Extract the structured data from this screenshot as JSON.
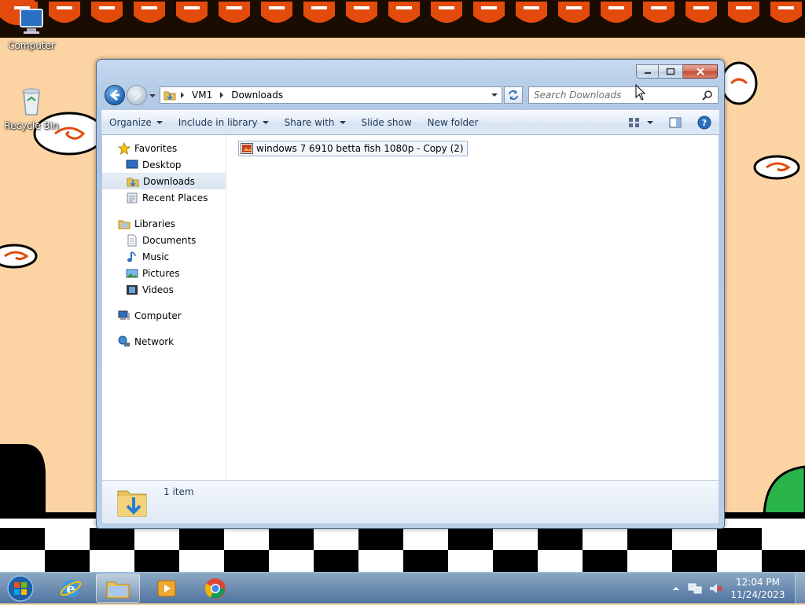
{
  "desktop": {
    "icons": [
      {
        "label": "Computer",
        "icon": "computer-icon"
      },
      {
        "label": "Recycle Bin",
        "icon": "recycle-bin-icon"
      }
    ]
  },
  "window": {
    "title": "Downloads",
    "breadcrumb": [
      "VM1",
      "Downloads"
    ],
    "search_placeholder": "Search Downloads",
    "toolbar": {
      "organize": "Organize",
      "include_in_library": "Include in library",
      "share_with": "Share with",
      "slide_show": "Slide show",
      "new_folder": "New folder"
    },
    "nav": {
      "favorites": {
        "label": "Favorites",
        "items": [
          "Desktop",
          "Downloads",
          "Recent Places"
        ]
      },
      "libraries": {
        "label": "Libraries",
        "items": [
          "Documents",
          "Music",
          "Pictures",
          "Videos"
        ]
      },
      "computer": "Computer",
      "network": "Network",
      "selected": "Downloads"
    },
    "files": [
      {
        "name": "windows 7 6910 betta fish 1080p - Copy (2)",
        "icon": "image-file-icon"
      }
    ],
    "details": {
      "count": "1 item"
    }
  },
  "taskbar": {
    "pinned": [
      "start-button",
      "internet-explorer",
      "windows-explorer",
      "media-player",
      "chrome"
    ],
    "active": "windows-explorer",
    "clock": {
      "time": "12:04 PM",
      "date": "11/24/2023"
    }
  },
  "colors": {
    "wallpaper_bg": "#fcd4a4",
    "wallpaper_red": "#e34b0c",
    "window_frame": "#b4cbe6",
    "toolbar_text": "#1e395b"
  }
}
